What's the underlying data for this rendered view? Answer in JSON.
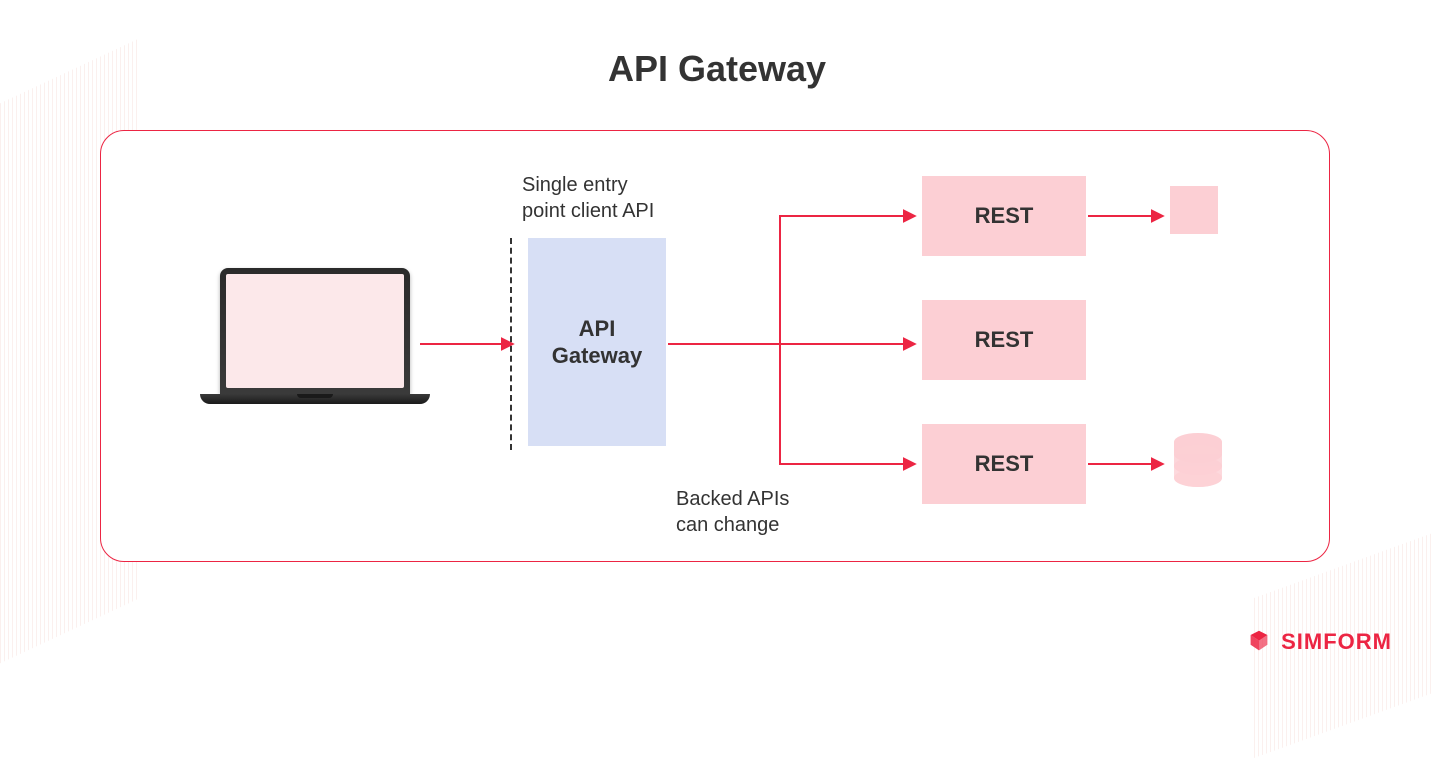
{
  "title": "API Gateway",
  "annotations": {
    "entry_point": "Single entry\npoint client API",
    "backed_apis": "Backed APIs\ncan change"
  },
  "gateway_label": "API\nGateway",
  "services": [
    {
      "label": "REST"
    },
    {
      "label": "REST"
    },
    {
      "label": "REST"
    }
  ],
  "brand": "SIMFORM",
  "colors": {
    "accent": "#ec2543",
    "pink": "#fccfd4",
    "blue": "#d7dff5"
  }
}
